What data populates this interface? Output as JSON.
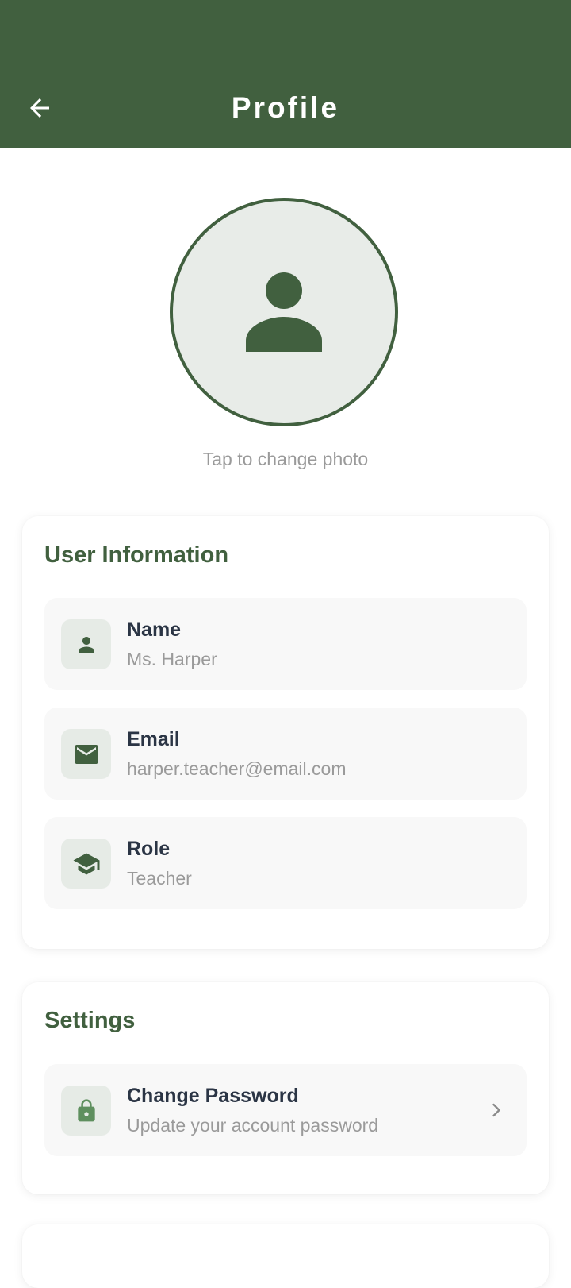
{
  "header": {
    "title": "Profile",
    "back_icon": "arrow-left-icon",
    "background": "#41603F"
  },
  "avatar": {
    "icon": "person-icon",
    "caption": "Tap to change photo"
  },
  "user_info": {
    "title": "User Information",
    "items": [
      {
        "icon": "person-icon",
        "label": "Name",
        "value": "Ms. Harper"
      },
      {
        "icon": "email-icon",
        "label": "Email",
        "value": "harper.teacher@email.com"
      },
      {
        "icon": "graduation-cap-icon",
        "label": "Role",
        "value": "Teacher"
      }
    ]
  },
  "settings": {
    "title": "Settings",
    "items": [
      {
        "icon": "lock-icon",
        "label": "Change Password",
        "value": "Update your account password",
        "trailing_icon": "chevron-right-icon"
      }
    ]
  },
  "colors": {
    "primary": "#41603F",
    "heading_text": "#2B3545",
    "secondary_text": "#9A9A9A",
    "icon_tile": "#E6EBE6"
  }
}
